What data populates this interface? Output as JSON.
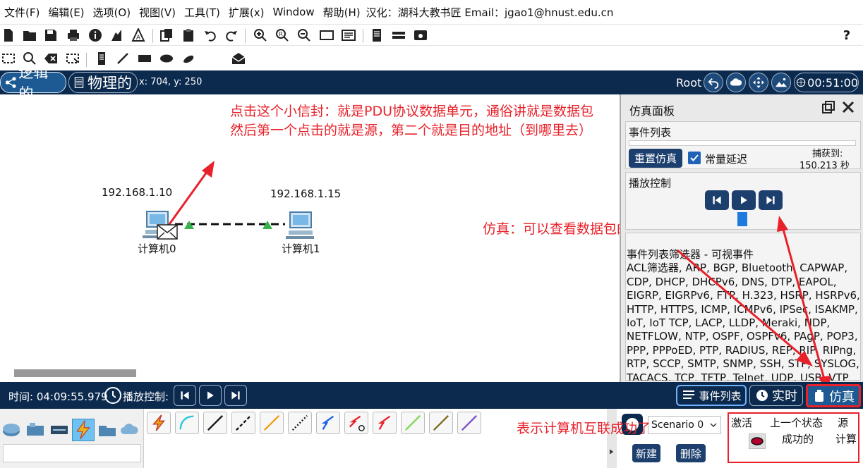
{
  "menu": {
    "items": [
      "文件(F)",
      "编辑(E)",
      "选项(O)",
      "视图(V)",
      "工具(T)",
      "扩展(x)",
      "Window",
      "帮助(H)"
    ],
    "credit": "汉化：湖科大教书匠  Email：jgao1@hnust.edu.cn"
  },
  "toolbar1": {
    "help_label": "?"
  },
  "modebar": {
    "logical_label": "逻辑的",
    "physical_label": "物理的",
    "coords": "x: 704, y: 250",
    "root_label": "Root",
    "clock": "00:51:00"
  },
  "workspace": {
    "pc0": {
      "ip": "192.168.1.10",
      "name": "计算机0"
    },
    "pc1": {
      "ip": "192.168.1.15",
      "name": "计算机1"
    }
  },
  "annotations": {
    "envelope_line1": "点击这个小信封：就是PDU协议数据单元，通俗讲就是数据包",
    "envelope_line2": "然后第一个点击的就是源，第二个就是目的地址（到哪里去）",
    "simulation_note": "仿真：可以查看数据包的发送过程",
    "success_note": "表示计算机互联成功了"
  },
  "sim_panel": {
    "title": "仿真面板",
    "event_list_label": "事件列表",
    "reset_label": "重置仿真",
    "constant_delay_label": "常量延迟",
    "captured_label": "捕获到:",
    "captured_time": "150.213 秒",
    "constant_delay_checked": true,
    "playback_label": "播放控制",
    "filter_title": "事件列表筛选器 - 可视事件",
    "filter_text": "ACL筛选器, ARP, BGP, Bluetooth, CAPWAP, CDP, DHCP, DHCPv6, DNS, DTP, EAPOL, EIGRP, EIGRPv6, FTP, H.323, HSRP, HSRPv6, HTTP, HTTPS, ICMP, ICMPv6, IPSec, ISAKMP, IoT, IoT TCP, LACP, LLDP, Meraki, NDP, NETFLOW, NTP, OSPF, OSPFv6, PAgP, POP3, PPP, PPPoED, PTP, RADIUS, REP, RIP, RIPng, RTP, SCCP, SMTP, SNMP, SSH, STP, SYSLOG, TACACS, TCP, TFTP, Telnet, UDP, USB, VTP"
  },
  "bottombar": {
    "time_label": "时间: 04:09:55.979",
    "playback_label": "播放控制:",
    "event_list_label": "事件列表",
    "realtime_label": "实时",
    "simulation_label": "仿真"
  },
  "scenario": {
    "selected": "Scenario 0",
    "new_label": "新建",
    "delete_label": "删除"
  },
  "event_table": {
    "col_active": "激活",
    "col_last_status": "上一个状态",
    "col_source": "源",
    "row_status": "成功的",
    "row_source": "计算"
  },
  "colors": {
    "navy": "#0c2a4e",
    "annotation_red": "#e8212a",
    "link_green": "#37b24d"
  }
}
